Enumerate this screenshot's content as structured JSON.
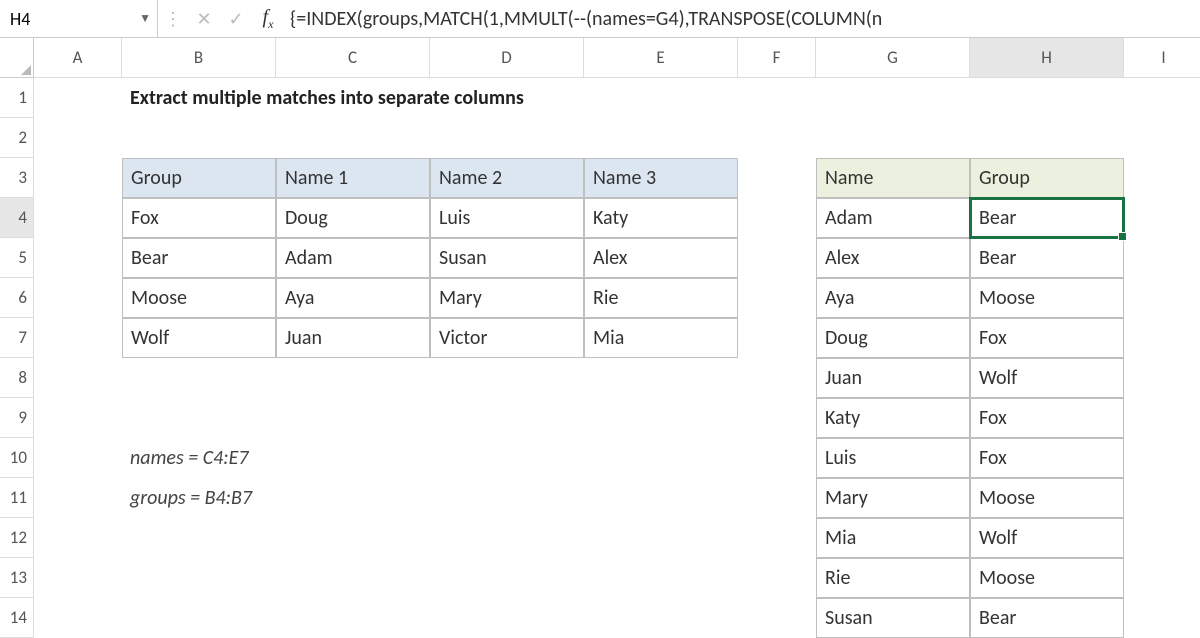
{
  "name_box": "H4",
  "formula": "{=INDEX(groups,MATCH(1,MMULT(--(names=G4),TRANSPOSE(COLUMN(n",
  "columns": [
    "A",
    "B",
    "C",
    "D",
    "E",
    "F",
    "G",
    "H",
    "I"
  ],
  "rows": [
    "1",
    "2",
    "3",
    "4",
    "5",
    "6",
    "7",
    "8",
    "9",
    "10",
    "11",
    "12",
    "13",
    "14"
  ],
  "title": "Extract multiple matches into separate columns",
  "table_left": {
    "headers": [
      "Group",
      "Name 1",
      "Name 2",
      "Name 3"
    ],
    "rows": [
      [
        "Fox",
        "Doug",
        "Luis",
        "Katy"
      ],
      [
        "Bear",
        "Adam",
        "Susan",
        "Alex"
      ],
      [
        "Moose",
        "Aya",
        "Mary",
        "Rie"
      ],
      [
        "Wolf",
        "Juan",
        "Victor",
        "Mia"
      ]
    ]
  },
  "table_right": {
    "headers": [
      "Name",
      "Group"
    ],
    "rows": [
      [
        "Adam",
        "Bear"
      ],
      [
        "Alex",
        "Bear"
      ],
      [
        "Aya",
        "Moose"
      ],
      [
        "Doug",
        "Fox"
      ],
      [
        "Juan",
        "Wolf"
      ],
      [
        "Katy",
        "Fox"
      ],
      [
        "Luis",
        "Fox"
      ],
      [
        "Mary",
        "Moose"
      ],
      [
        "Mia",
        "Wolf"
      ],
      [
        "Rie",
        "Moose"
      ],
      [
        "Susan",
        "Bear"
      ]
    ]
  },
  "notes": {
    "names_def": "names = C4:E7",
    "groups_def": "groups = B4:B7"
  },
  "active": {
    "col": "H",
    "row": "4"
  }
}
